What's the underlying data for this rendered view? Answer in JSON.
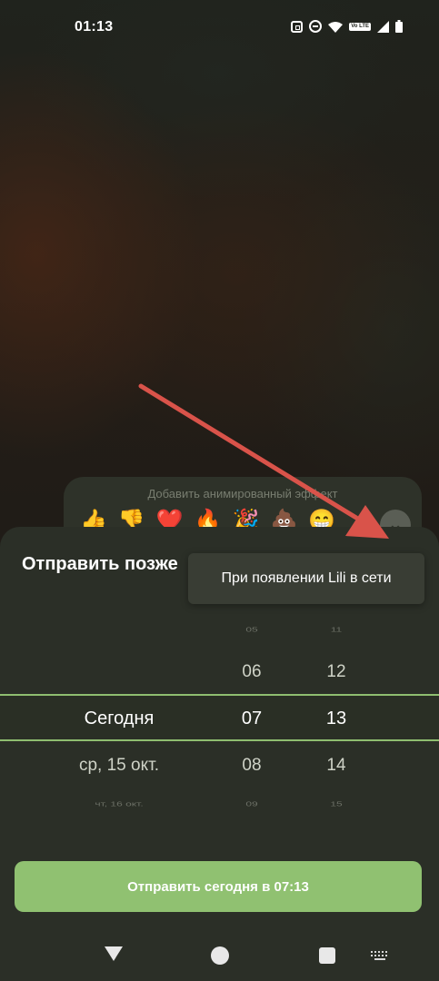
{
  "status_bar": {
    "time": "01:13",
    "icons": [
      "nfc-icon",
      "dnd-icon",
      "wifi-icon",
      "volte-icon",
      "signal-icon",
      "battery-icon"
    ],
    "lte_badge": "Vo LTE"
  },
  "reactions": {
    "hint": "Добавить анимированный эффект",
    "emojis": [
      "👍",
      "👎",
      "❤️",
      "🔥",
      "🎉",
      "💩",
      "😁"
    ]
  },
  "schedule_sheet": {
    "title": "Отправить позже",
    "picker": {
      "days": [
        "",
        "",
        "Сегодня",
        "ср, 15 окт.",
        "чт, 16 окт."
      ],
      "hours": [
        "05",
        "06",
        "07",
        "08",
        "09"
      ],
      "minutes": [
        "11",
        "12",
        "13",
        "14",
        "15"
      ]
    },
    "send_button": "Отправить сегодня в 07:13"
  },
  "popup_menu": {
    "option": "При появлении Lili в сети"
  },
  "colors": {
    "accent": "#90c171",
    "sheet_bg": "#2b2f27",
    "arrow": "#d9534a"
  }
}
